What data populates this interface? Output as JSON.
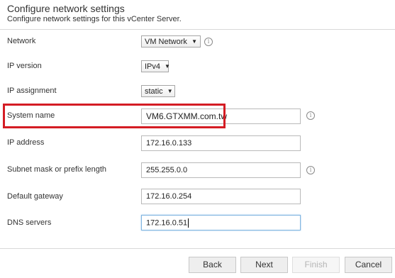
{
  "header": {
    "title": "Configure network settings",
    "subtitle": "Configure network settings for this vCenter Server."
  },
  "form": {
    "network": {
      "label": "Network",
      "value": "VM Network"
    },
    "ip_version": {
      "label": "IP version",
      "value": "IPv4"
    },
    "ip_assignment": {
      "label": "IP assignment",
      "value": "static"
    },
    "system_name": {
      "label": "System name",
      "value": "VM6.GTXMM.com.tw"
    },
    "ip_address": {
      "label": "IP address",
      "value": "172.16.0.133"
    },
    "subnet_mask": {
      "label": "Subnet mask or prefix length",
      "value": "255.255.0.0"
    },
    "default_gateway": {
      "label": "Default gateway",
      "value": "172.16.0.254"
    },
    "dns_servers": {
      "label": "DNS servers",
      "value": "172.16.0.51"
    }
  },
  "footer": {
    "back": "Back",
    "next": "Next",
    "finish": "Finish",
    "cancel": "Cancel"
  },
  "icons": {
    "info": "i",
    "dropdown": "▼"
  },
  "colors": {
    "highlight": "#d41c24",
    "focus_border": "#7fb4e0"
  }
}
